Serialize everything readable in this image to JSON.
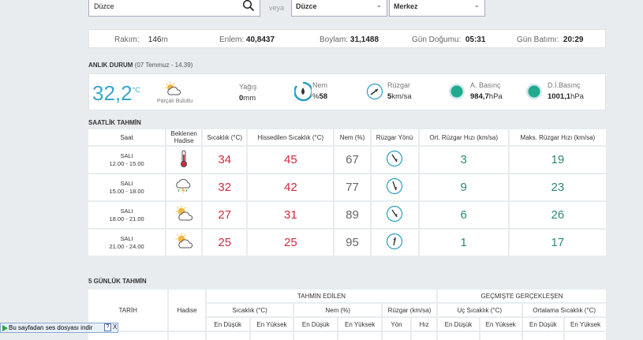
{
  "search": {
    "city_value": "Düzce",
    "or_label": "veya",
    "province_select": "Düzce",
    "district_select": "Merkez"
  },
  "info": {
    "rakim_label": "Rakım:",
    "rakim_value": "146",
    "rakim_unit": "m",
    "enlem_label": "Enlem:",
    "enlem_value": "40,8437",
    "boylam_label": "Boylam:",
    "boylam_value": "31,1488",
    "gundogumu_label": "Gün Doğumu:",
    "gundogumu_value": "05:31",
    "gunbatimi_label": "Gün Batımı:",
    "gunbatimi_value": "20:29"
  },
  "current": {
    "title": "ANLIK DURUM",
    "date": "(07 Temmuz - 14.39)",
    "temperature": "32,2",
    "temp_unit": "°C",
    "condition": "Parçalı Bulutlu",
    "yagis_label": "Yağış",
    "yagis_value": "0",
    "yagis_unit": "mm",
    "nem_label": "Nem",
    "nem_prefix": "%",
    "nem_value": "58",
    "ruzgar_label": "Rüzgar",
    "ruzgar_value": "5",
    "ruzgar_unit": "km/sa",
    "abasinc_label": "A. Basınç",
    "abasinc_value": "984,7",
    "abasinc_unit": "hPa",
    "dibasinc_label": "D.İ.Basınç",
    "dibasinc_value": "1001,1",
    "dibasinc_unit": "hPa"
  },
  "hourly": {
    "title": "SAATLİK TAHMİN",
    "headers": [
      "Saat",
      "Beklenen Hadise",
      "Sıcaklık (°C)",
      "Hissedilen Sıcaklık (°C)",
      "Nem (%)",
      "Rüzgar Yönü",
      "Ort. Rüzgar Hızı (km/sa)",
      "Maks. Rüzgar Hızı (km/sa)"
    ],
    "rows": [
      {
        "day": "SALI",
        "range": "12.00 - 15.00",
        "icon": "thermometer-hot-icon",
        "temp": "34",
        "feel": "45",
        "humidity": "67",
        "wind_dir": "SE",
        "avg_wind": "3",
        "max_wind": "19"
      },
      {
        "day": "SALI",
        "range": "15.00 - 18.00",
        "icon": "thunderstorm-icon",
        "temp": "32",
        "feel": "42",
        "humidity": "77",
        "wind_dir": "SE",
        "avg_wind": "9",
        "max_wind": "23"
      },
      {
        "day": "SALI",
        "range": "18.00 - 21.00",
        "icon": "partly-cloudy-icon",
        "temp": "27",
        "feel": "31",
        "humidity": "89",
        "wind_dir": "SE",
        "avg_wind": "6",
        "max_wind": "26"
      },
      {
        "day": "SALI",
        "range": "21.00 - 24.00",
        "icon": "partly-cloudy-icon",
        "temp": "25",
        "feel": "25",
        "humidity": "95",
        "wind_dir": "N",
        "avg_wind": "1",
        "max_wind": "17"
      }
    ]
  },
  "daily": {
    "title": "5 GÜNLÜK TAHMİN",
    "tarih": "TARİH",
    "hadise": "Hadise",
    "tahmin_edilen": "TAHMİN EDİLEN",
    "gecmiste": "GEÇMİŞTE GERÇEKLEŞEN",
    "sicaklik": "Sıcaklık (°C)",
    "nem": "Nem (%)",
    "ruzgar": "Rüzgar (km/sa)",
    "uc_sicaklik": "Uç Sıcaklık (°C)",
    "ort_sicaklik": "Ortalama Sıcaklık (°C)",
    "en_dusuk": "En Düşük",
    "en_yuksek": "En Yüksek",
    "yon": "Yön",
    "hiz": "Hız"
  },
  "audio_bar": {
    "label": "Bu sayfadan ses dosyası indir",
    "help": "?",
    "close": "X"
  }
}
